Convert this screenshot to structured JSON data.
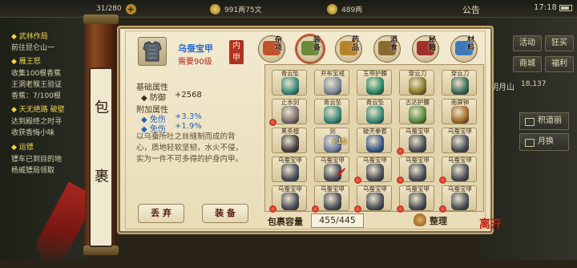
{
  "topbar": {
    "res1": "31/280",
    "res2": "991两75文",
    "res3": "489两",
    "announce": "公告",
    "time": "17:18"
  },
  "quests": [
    {
      "text": "◆ 武林作局",
      "title": true
    },
    {
      "text": "前往昆仑山一"
    },
    {
      "text": "◆ 雁王怒",
      "title": true
    },
    {
      "text": "收集100根香蕉"
    },
    {
      "text": "王洞老猴王验证"
    },
    {
      "text": "香蕉：7/100根"
    },
    {
      "text": "◆ 天无绝路 破壁",
      "title": true
    },
    {
      "text": "达到殿终之时寻"
    },
    {
      "text": "收获香悔小味"
    },
    {
      "text": "◆ 运镖",
      "title": true
    },
    {
      "text": "镖车已到目的地"
    },
    {
      "text": "杨威镖局领取"
    }
  ],
  "right_buttons": [
    "活动",
    "狂买",
    "商城",
    "福利"
  ],
  "map": {
    "name": "明月山",
    "coord": "18,137"
  },
  "side_tabs": [
    "积道丽",
    "月换"
  ],
  "strip": [
    "包",
    "裹"
  ],
  "item": {
    "name": "乌蚕宝甲",
    "requirement": "需要90级",
    "slot": [
      "内",
      "甲"
    ],
    "base_title": "基础属性",
    "base_stats": [
      {
        "label": "◆ 防御",
        "value": "+2568"
      }
    ],
    "extra_title": "附加属性",
    "extra_stats": [
      {
        "label": "◆ 免伤",
        "value": "+3.3%"
      },
      {
        "label": "◆ 免伤",
        "value": "+1.9%"
      }
    ],
    "description": "以乌蚕所吐之丝缝制而成的背心，质地轻软坚韧，水火不侵，实为一件不可多得的护身内甲。",
    "discard_label": "丢 弃",
    "equip_label": "装 备"
  },
  "categories": [
    {
      "label": "杂项",
      "color": "#c0522a"
    },
    {
      "label": "装备",
      "color": "#6b8a3a",
      "active": true
    },
    {
      "label": "药品",
      "color": "#b8842a"
    },
    {
      "label": "酒食",
      "color": "#8a6a30"
    },
    {
      "label": "秘籍",
      "color": "#a0302a"
    },
    {
      "label": "材料",
      "color": "#3a7ab8"
    }
  ],
  "grid": [
    {
      "name": "青云坠",
      "color": "#3a8a7a"
    },
    {
      "name": "并布宝戒",
      "color": "#7a8a9a"
    },
    {
      "name": "玉带护腰",
      "color": "#2a8a6a"
    },
    {
      "name": "穿云刀",
      "color": "#8a7a2a"
    },
    {
      "name": "穿云刀",
      "color": "#3a6a5a"
    },
    {
      "name": "止水剑",
      "color": "#7a7070",
      "dot": true
    },
    {
      "name": "青云坠",
      "color": "#3a8a7a"
    },
    {
      "name": "青云坠",
      "color": "#3a8a7a"
    },
    {
      "name": "古达护腰",
      "color": "#5a8a3a"
    },
    {
      "name": "南屏钟",
      "color": "#a06a2a"
    },
    {
      "name": "黑杀棍",
      "color": "#4a4040"
    },
    {
      "name": "剑",
      "color": "#7080a0",
      "badge": "+15"
    },
    {
      "name": "破天拳套",
      "color": "#3a5a8a"
    },
    {
      "name": "乌蚕宝甲",
      "color": "#4a5058",
      "dot": true
    },
    {
      "name": "乌蚕宝甲",
      "color": "#4a5058"
    },
    {
      "name": "乌蚕宝甲",
      "color": "#4a5058"
    },
    {
      "name": "乌蚕宝甲",
      "color": "#4a5058",
      "check": true
    },
    {
      "name": "乌蚕宝甲",
      "color": "#4a5058",
      "dot": true
    },
    {
      "name": "乌蚕宝甲",
      "color": "#4a5058",
      "dot": true
    },
    {
      "name": "乌蚕宝甲",
      "color": "#4a5058",
      "dot": true
    },
    {
      "name": "乌蚕宝甲",
      "color": "#4a5058",
      "dot": true
    },
    {
      "name": "乌蚕宝甲",
      "color": "#4a5058",
      "dot": true
    },
    {
      "name": "乌蚕宝甲",
      "color": "#4a5058",
      "dot": true
    },
    {
      "name": "乌蚕宝甲",
      "color": "#4a5058",
      "dot": true
    },
    {
      "name": "乌蚕宝甲",
      "color": "#4a5058",
      "dot": true
    }
  ],
  "capacity": {
    "label": "包裹容量",
    "value": "455/445"
  },
  "sort_label": "整理",
  "seal": "离开"
}
